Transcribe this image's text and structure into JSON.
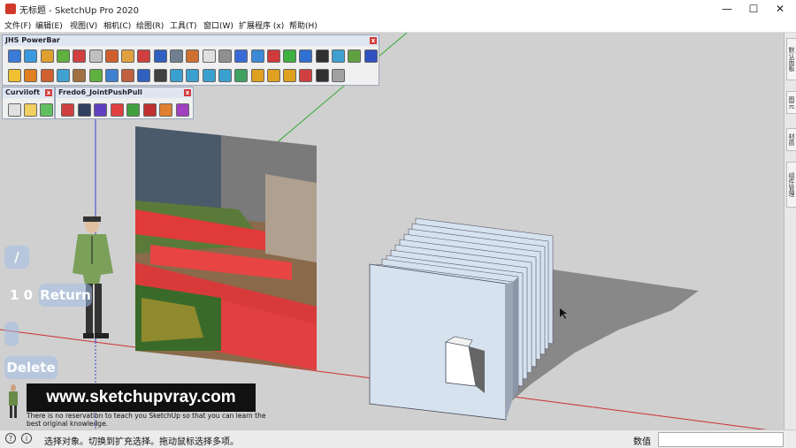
{
  "window": {
    "title": "无标题 - SketchUp Pro 2020",
    "minimize": "—",
    "maximize": "☐",
    "close": "✕"
  },
  "menu": [
    "文件(F)",
    "编辑(E)",
    "视图(V)",
    "相机(C)",
    "绘图(R)",
    "工具(T)",
    "窗口(W)",
    "扩展程序 (x)",
    "帮助(H)"
  ],
  "toolbars": {
    "powerbar": {
      "title": "JHS PowerBar",
      "close": "x"
    },
    "curviloft": {
      "title": "Curviloft",
      "close": "x"
    },
    "fredo": {
      "title": "Fredo6_JointPushPull",
      "close": "x"
    }
  },
  "right_tabs": [
    "默认面板",
    "图元",
    "材质",
    "组件管理"
  ],
  "overlay": {
    "slash": "/",
    "digits": "1 0",
    "return_label": "Return",
    "delete_label": "Delete"
  },
  "banner": {
    "url": "www.sketchupvray.com",
    "subtitle": "There is no reservation to teach you SketchUp so that you can learn the best original knowledge."
  },
  "status": {
    "text": "选择对象。切换到扩充选择。拖动鼠标选择多项。",
    "measurements_label": "数值",
    "measurements_value": ""
  },
  "colors": {
    "background": "#d0d0d0",
    "red_axis": "#cc3333",
    "green_axis": "#33aa33",
    "blue_axis": "#3344cc",
    "fin_face": "#d6e3ef",
    "shadow": "#888888"
  }
}
